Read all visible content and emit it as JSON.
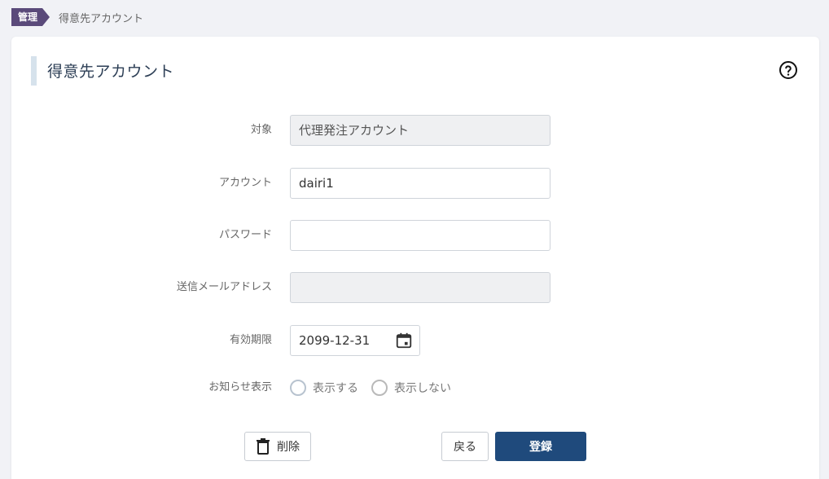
{
  "colors": {
    "brand": "#5a4a7a",
    "primary": "#1f4a7c",
    "title_accent": "#d6e2ec"
  },
  "breadcrumb": {
    "tag": "管理",
    "current": "得意先アカウント"
  },
  "page": {
    "title": "得意先アカウント",
    "help_icon": "question-circle-icon"
  },
  "form": {
    "target": {
      "label": "対象",
      "value": "代理発注アカウント"
    },
    "account": {
      "label": "アカウント",
      "value": "dairi1"
    },
    "password": {
      "label": "パスワード",
      "value": ""
    },
    "sender_email": {
      "label": "送信メールアドレス",
      "value": ""
    },
    "expiry": {
      "label": "有効期限",
      "value": "2099-12-31",
      "icon": "calendar-icon"
    },
    "notice_display": {
      "label": "お知らせ表示",
      "options": [
        "表示する",
        "表示しない"
      ],
      "selected": null
    }
  },
  "actions": {
    "delete_label": "削除",
    "delete_icon": "trash-icon",
    "back_label": "戻る",
    "register_label": "登録"
  }
}
